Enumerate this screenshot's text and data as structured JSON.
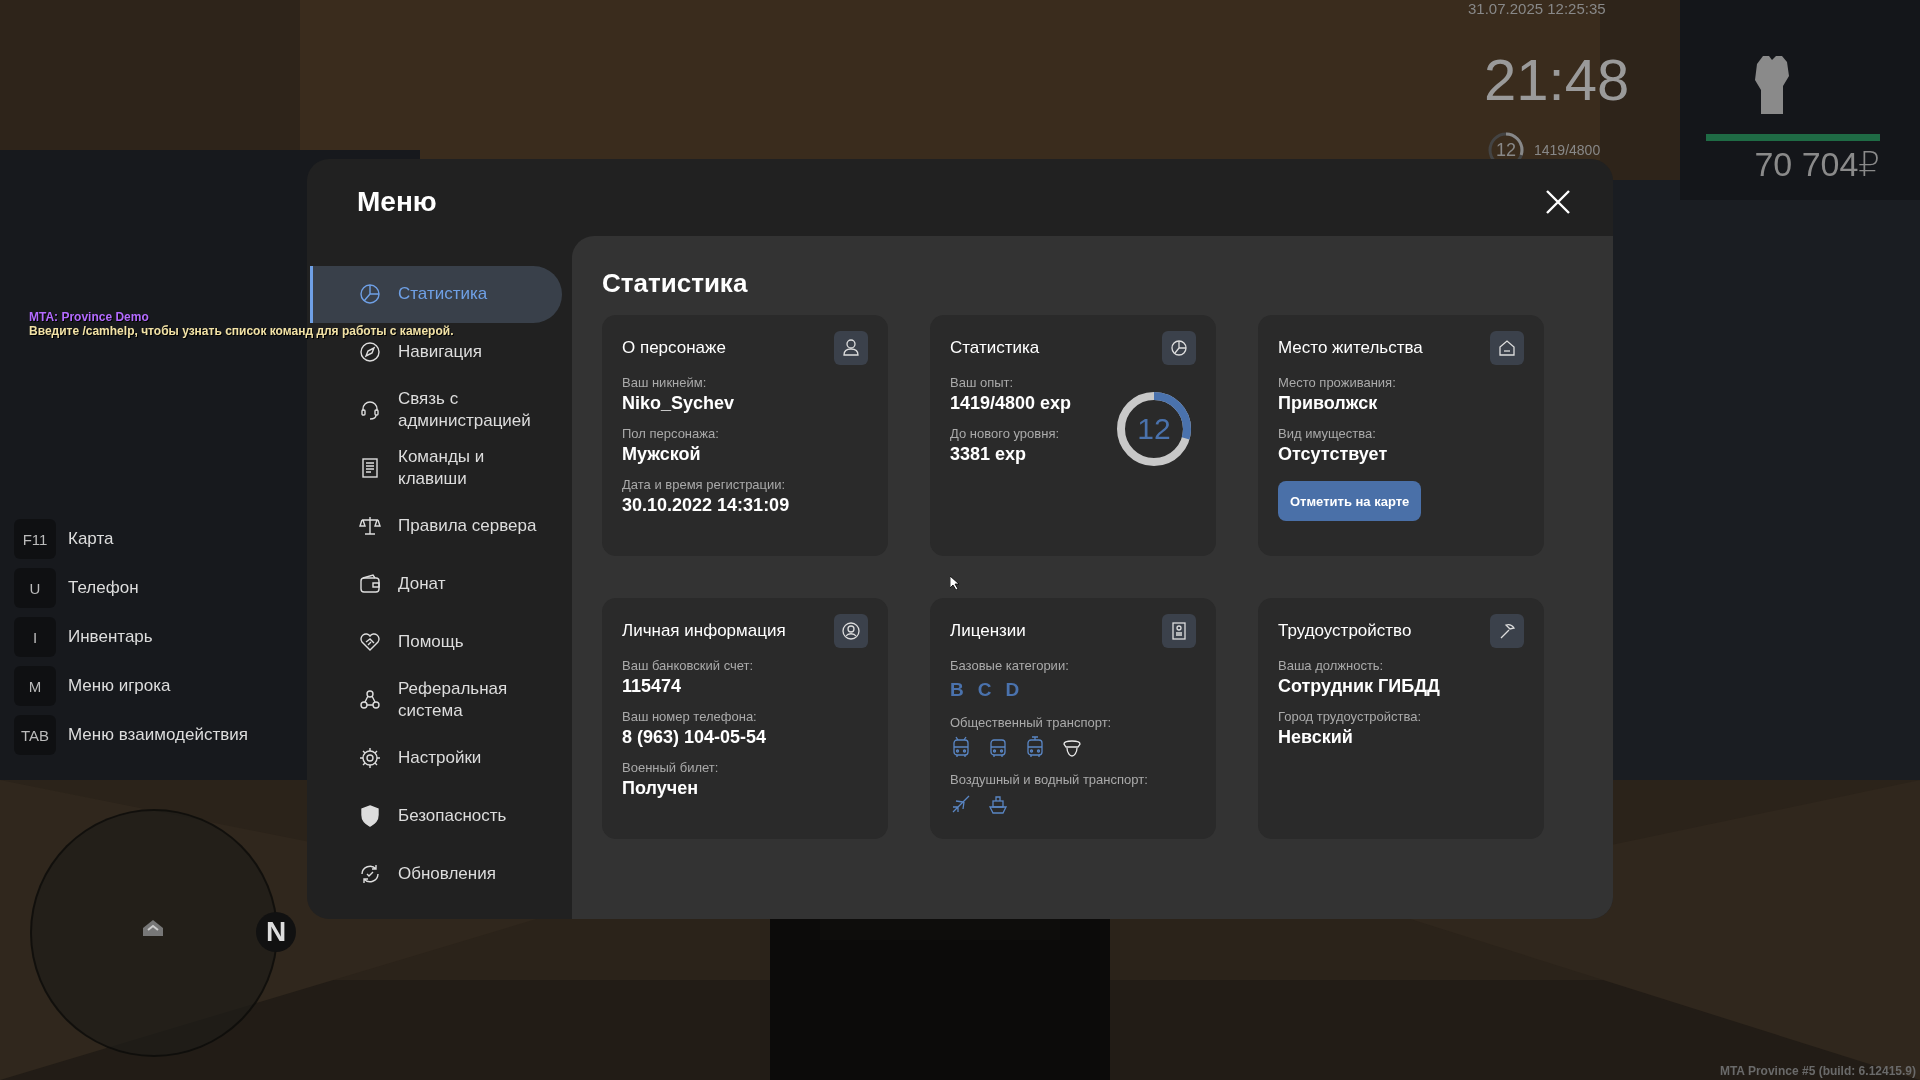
{
  "hud": {
    "datetime": "31.07.2025 12:25:35",
    "clock": "21:48",
    "level_ring": {
      "label": "12",
      "level": 0.3
    },
    "experience": "1419/4800",
    "health_bar": {
      "level": 1
    },
    "money": "70 704₽"
  },
  "chat": [
    {
      "text": "MTA: Province Demo",
      "color": "#b36bff"
    },
    {
      "text": "Введите /camhelp, чтобы узнать список команд для работы с камерой.",
      "color": "#f2e2a6"
    }
  ],
  "hotkeys": [
    {
      "key": "F11",
      "label": "Карта"
    },
    {
      "key": "U",
      "label": "Телефон"
    },
    {
      "key": "I",
      "label": "Инвентарь"
    },
    {
      "key": "M",
      "label": "Меню игрока"
    },
    {
      "key": "TAB",
      "label": "Меню взаимодействия"
    }
  ],
  "minimap": {
    "compass": "N"
  },
  "menu": {
    "title": "Меню",
    "sidebar": [
      {
        "label": "Статистика",
        "selected": true
      },
      {
        "label": "Навигация",
        "selected": false
      },
      {
        "label": "Связь с администрацией",
        "selected": false
      },
      {
        "label": "Команды и клавиши",
        "selected": false
      },
      {
        "label": "Правила сервера",
        "selected": false
      },
      {
        "label": "Донат",
        "selected": false
      },
      {
        "label": "Помощь",
        "selected": false
      },
      {
        "label": "Реферальная система",
        "selected": false
      },
      {
        "label": "Настройки",
        "selected": false
      },
      {
        "label": "Безопасность",
        "selected": false
      },
      {
        "label": "Обновления",
        "selected": false
      }
    ],
    "page_title": "Статистика",
    "cards": [
      {
        "kind": "fields",
        "title": "О персонаже",
        "fields": [
          {
            "label": "Ваш никнейм:",
            "value": "Niko_Sychev"
          },
          {
            "label": "Пол персонажа:",
            "value": "Мужской"
          },
          {
            "label": "Дата и время регистрации:",
            "value": "30.10.2022 14:31:09"
          }
        ]
      },
      {
        "kind": "stats",
        "title": "Статистика",
        "fields": [
          {
            "label": "Ваш опыт:",
            "value": "1419/4800 exp"
          },
          {
            "label": "До нового уровня:",
            "value": "3381 exp"
          }
        ],
        "ring": {
          "label": "12",
          "level": 0.296
        }
      },
      {
        "kind": "fields",
        "title": "Место жительства",
        "fields": [
          {
            "label": "Место проживания:",
            "value": "Приволжск"
          },
          {
            "label": "Вид имущества:",
            "value": "Отсутствует"
          }
        ],
        "button": "Отметить на карте"
      },
      {
        "kind": "fields",
        "title": "Личная информация",
        "fields": [
          {
            "label": "Ваш банковский счет:",
            "value": "115474"
          },
          {
            "label": "Ваш номер телефона:",
            "value": "8 (963) 104-05-54"
          },
          {
            "label": "Военный билет:",
            "value": "Получен"
          }
        ]
      },
      {
        "kind": "licenses",
        "title": "Лицензии",
        "categories_label": "Базовые категории:",
        "categories": [
          "B",
          "C",
          "D"
        ],
        "public_label": "Общественный транспорт:",
        "public": [
          {
            "active": true
          },
          {
            "active": true
          },
          {
            "active": true
          },
          {
            "active": false
          }
        ],
        "air_label": "Воздушный и водный транспорт:",
        "air": [
          {
            "active": true
          },
          {
            "active": true
          }
        ]
      },
      {
        "kind": "fields",
        "title": "Трудоустройство",
        "fields": [
          {
            "label": "Ваша должность:",
            "value": "Сотрудник ГИБДД"
          },
          {
            "label": "Город трудоустройства:",
            "value": "Невский"
          }
        ]
      }
    ]
  },
  "build": "MTA Province #5 (build: 6.12415.9)"
}
